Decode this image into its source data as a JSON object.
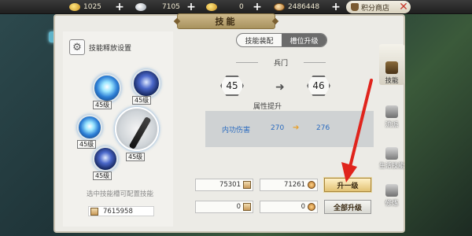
{
  "currency": {
    "gold": "1025",
    "silver": "7105",
    "yuanbao": "0",
    "coins": "2486448",
    "shop_label": "积分商店"
  },
  "window": {
    "title": "技能"
  },
  "left": {
    "config_label": "技能释放设置",
    "skills": [
      {
        "level": "45级"
      },
      {
        "level": "45级"
      },
      {
        "level": "45级"
      },
      {
        "level": "45级"
      },
      {
        "level": "45级"
      }
    ],
    "hint": "选中技能槽可配置技能",
    "points": "7615958"
  },
  "tabs": {
    "equip": "技能装配",
    "upgrade": "槽位升级"
  },
  "upgrade": {
    "section_title": "兵门",
    "from_level": "45",
    "to_level": "46",
    "attr_title": "属性提升",
    "attr_name": "内功伤害",
    "attr_from": "270",
    "attr_to": "276"
  },
  "cost": {
    "row1_scroll": "75301",
    "row1_coin": "71261",
    "row2_scroll": "0",
    "row2_coin": "0",
    "upgrade_one": "升一级",
    "upgrade_all": "全部升级"
  },
  "side_tabs": [
    {
      "label": "技能"
    },
    {
      "label": "流派"
    },
    {
      "label": "生活技能"
    },
    {
      "label": "修炼"
    }
  ],
  "colors": {
    "attr_blue": "#2a6bbf",
    "accent_gold": "#e2c274",
    "arrow_red": "#e0241c"
  }
}
